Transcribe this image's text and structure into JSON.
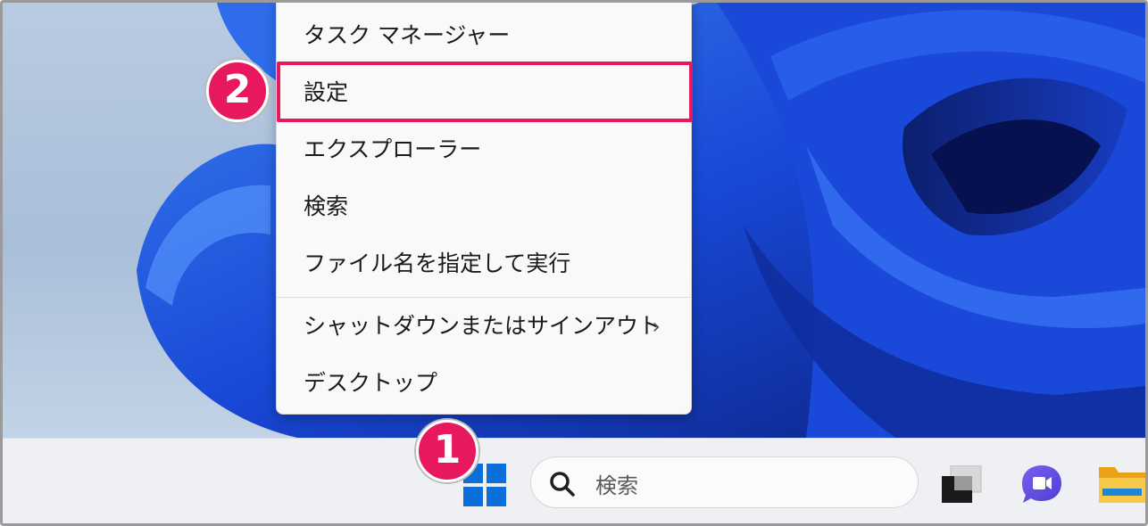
{
  "context_menu": {
    "items": [
      {
        "label": "タスク マネージャー"
      },
      {
        "label": "設定"
      },
      {
        "label": "エクスプローラー"
      },
      {
        "label": "検索"
      },
      {
        "label": "ファイル名を指定して実行"
      },
      {
        "label": "シャットダウンまたはサインアウト"
      },
      {
        "label": "デスクトップ"
      }
    ],
    "submenu_chevron": "›"
  },
  "annotations": {
    "step1": "1",
    "step2": "2"
  },
  "taskbar": {
    "search_placeholder": "検索",
    "icons": [
      "windows-start-icon",
      "search-icon",
      "task-view-icon",
      "teams-chat-icon",
      "file-explorer-icon"
    ]
  },
  "colors": {
    "highlight": "#e8185f",
    "windows_blue": "#0a6fd8"
  }
}
